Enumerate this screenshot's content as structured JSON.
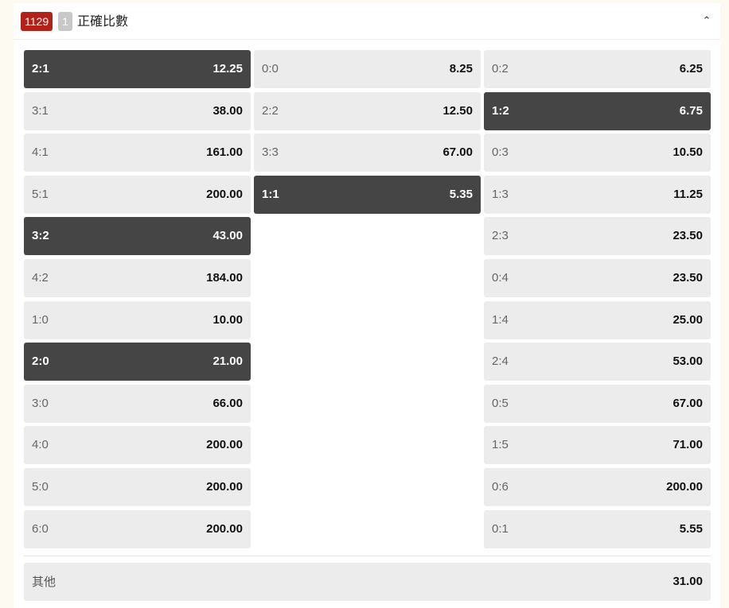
{
  "header": {
    "match_id": "1129",
    "count": "1",
    "title": "正確比數",
    "collapse_icon": "chevron-up-icon",
    "collapse_glyph": "⌃"
  },
  "colors": {
    "badge_red": "#b3221a",
    "selected_bg": "#454545",
    "cell_bg": "#ececec"
  },
  "columns": [
    [
      {
        "score": "2:1",
        "odds": "12.25",
        "selected": true
      },
      {
        "score": "3:1",
        "odds": "38.00",
        "selected": false
      },
      {
        "score": "4:1",
        "odds": "161.00",
        "selected": false
      },
      {
        "score": "5:1",
        "odds": "200.00",
        "selected": false
      },
      {
        "score": "3:2",
        "odds": "43.00",
        "selected": true
      },
      {
        "score": "4:2",
        "odds": "184.00",
        "selected": false
      },
      {
        "score": "1:0",
        "odds": "10.00",
        "selected": false
      },
      {
        "score": "2:0",
        "odds": "21.00",
        "selected": true
      },
      {
        "score": "3:0",
        "odds": "66.00",
        "selected": false
      },
      {
        "score": "4:0",
        "odds": "200.00",
        "selected": false
      },
      {
        "score": "5:0",
        "odds": "200.00",
        "selected": false
      },
      {
        "score": "6:0",
        "odds": "200.00",
        "selected": false
      }
    ],
    [
      {
        "score": "0:0",
        "odds": "8.25",
        "selected": false
      },
      {
        "score": "2:2",
        "odds": "12.50",
        "selected": false
      },
      {
        "score": "3:3",
        "odds": "67.00",
        "selected": false
      },
      {
        "score": "1:1",
        "odds": "5.35",
        "selected": true
      }
    ],
    [
      {
        "score": "0:2",
        "odds": "6.25",
        "selected": false
      },
      {
        "score": "1:2",
        "odds": "6.75",
        "selected": true
      },
      {
        "score": "0:3",
        "odds": "10.50",
        "selected": false
      },
      {
        "score": "1:3",
        "odds": "11.25",
        "selected": false
      },
      {
        "score": "2:3",
        "odds": "23.50",
        "selected": false
      },
      {
        "score": "0:4",
        "odds": "23.50",
        "selected": false
      },
      {
        "score": "1:4",
        "odds": "25.00",
        "selected": false
      },
      {
        "score": "2:4",
        "odds": "53.00",
        "selected": false
      },
      {
        "score": "0:5",
        "odds": "67.00",
        "selected": false
      },
      {
        "score": "1:5",
        "odds": "71.00",
        "selected": false
      },
      {
        "score": "0:6",
        "odds": "200.00",
        "selected": false
      },
      {
        "score": "0:1",
        "odds": "5.55",
        "selected": false
      }
    ]
  ],
  "other": {
    "label": "其他",
    "odds": "31.00"
  }
}
